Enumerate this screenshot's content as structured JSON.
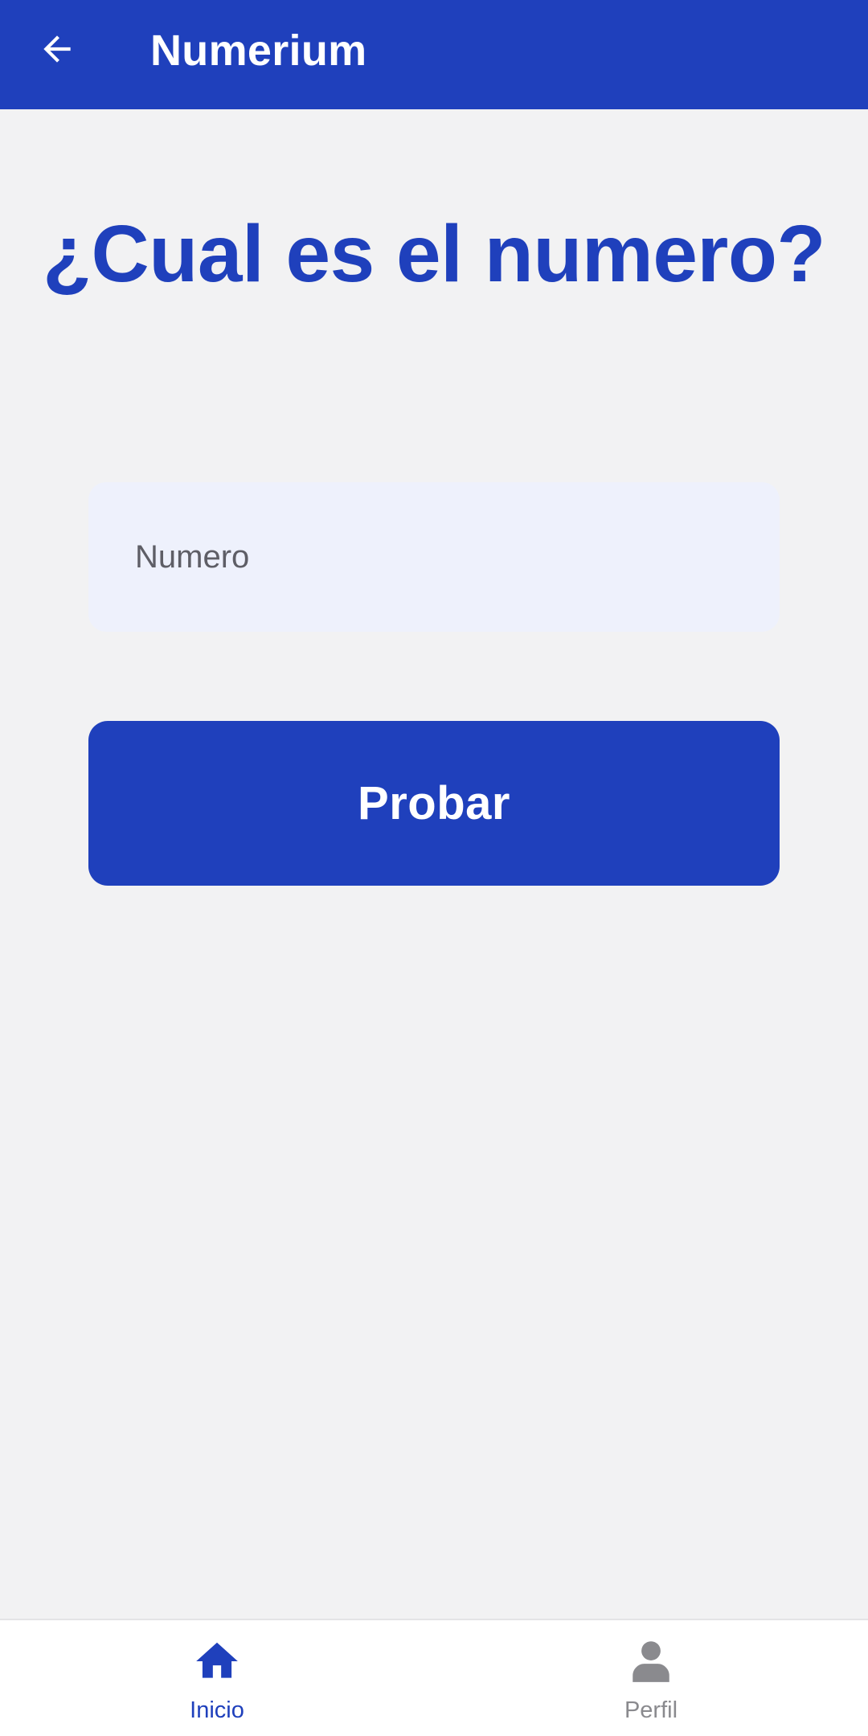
{
  "app": {
    "title": "Numerium",
    "accent_color": "#1f40bc",
    "background_color": "#f2f2f3"
  },
  "appbar": {
    "back_icon": "arrow-back-icon"
  },
  "main": {
    "question": "¿Cual es el numero?",
    "number_input": {
      "placeholder": "Numero",
      "value": ""
    },
    "submit_label": "Probar"
  },
  "bottom_nav": {
    "items": [
      {
        "label": "Inicio",
        "icon": "home-icon",
        "active": true
      },
      {
        "label": "Perfil",
        "icon": "person-icon",
        "active": false
      }
    ]
  }
}
